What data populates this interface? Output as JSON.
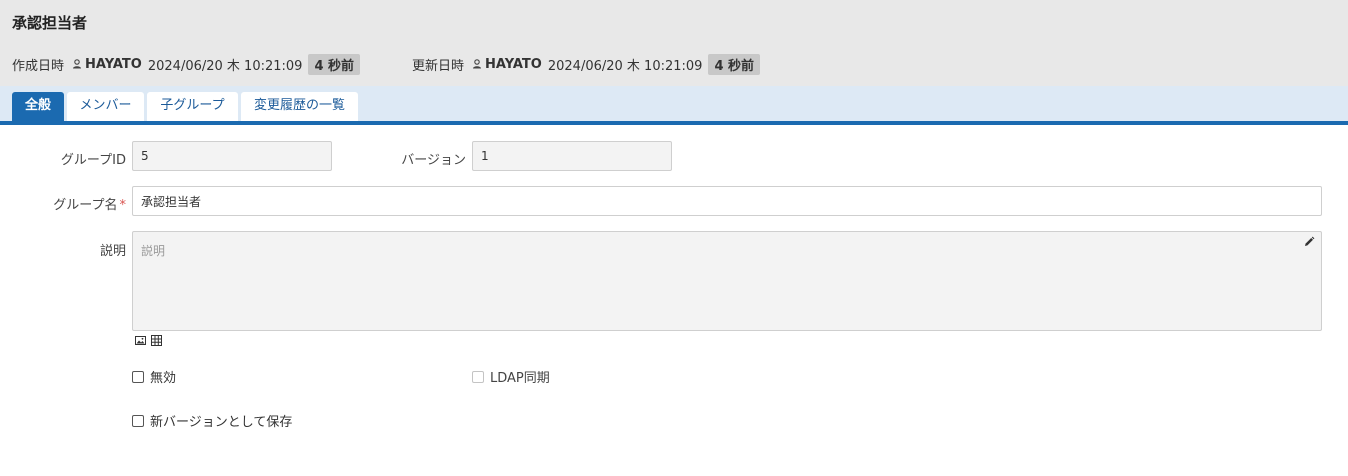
{
  "header": {
    "title": "承認担当者",
    "created": {
      "label": "作成日時",
      "user": "HAYATO",
      "date": "2024/06/20 木 10:21:09",
      "ago": "4 秒前"
    },
    "updated": {
      "label": "更新日時",
      "user": "HAYATO",
      "date": "2024/06/20 木 10:21:09",
      "ago": "4 秒前"
    }
  },
  "tabs": [
    {
      "label": "全般",
      "active": true
    },
    {
      "label": "メンバー",
      "active": false
    },
    {
      "label": "子グループ",
      "active": false
    },
    {
      "label": "変更履歴の一覧",
      "active": false
    }
  ],
  "form": {
    "group_id": {
      "label": "グループID",
      "value": "5"
    },
    "version": {
      "label": "バージョン",
      "value": "1"
    },
    "group_name": {
      "label": "グループ名",
      "required_mark": "*",
      "value": "承認担当者"
    },
    "description": {
      "label": "説明",
      "placeholder": "説明"
    },
    "disabled": {
      "label": "無効",
      "checked": false
    },
    "ldap_sync": {
      "label": "LDAP同期",
      "checked": false,
      "enabled": false
    },
    "save_as_new_version": {
      "label": "新バージョンとして保存",
      "checked": false
    }
  },
  "colors": {
    "header_bg": "#e8e8e8",
    "tabbar_bg": "#dde9f5",
    "accent": "#1b6ab0",
    "required": "#d9534f"
  },
  "icons": {
    "user": "user-icon",
    "edit": "pencil-icon",
    "image": "image-icon",
    "table": "table-icon"
  }
}
